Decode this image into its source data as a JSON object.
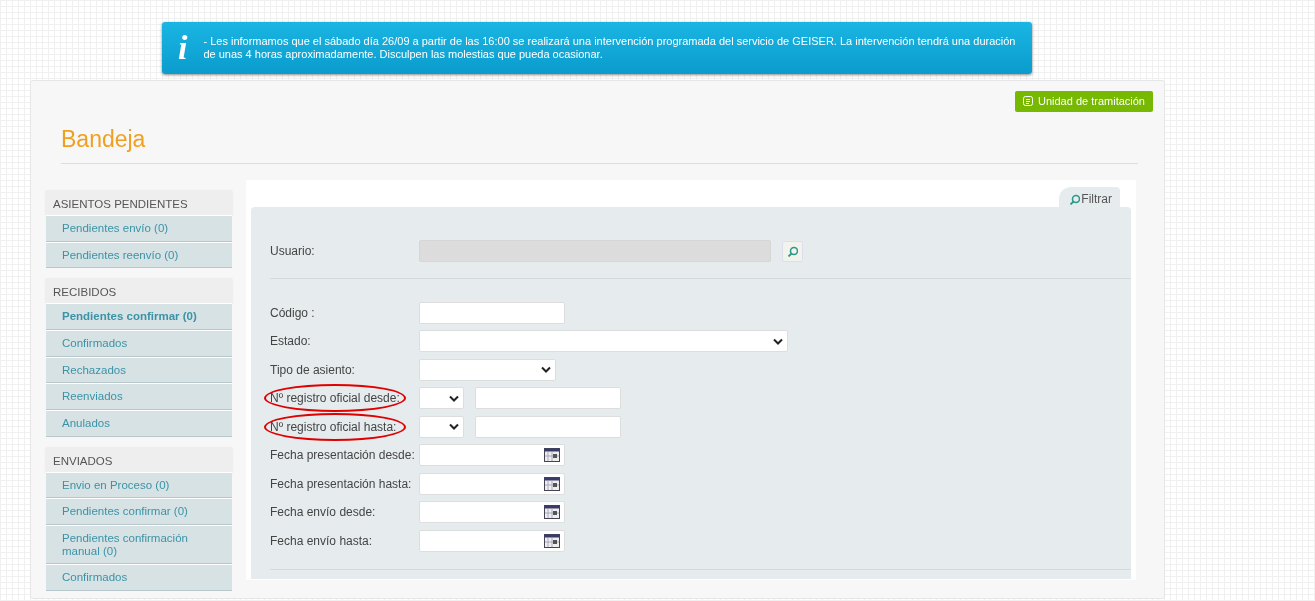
{
  "notice": {
    "icon": "i",
    "text": "- Les informamos que el sábado día 26/09 a partir de las 16:00 se realizará una intervención programada del servicio de GEISER. La intervención tendrá una duración de unas 4 horas aproximadamente. Disculpen las molestias que pueda ocasionar."
  },
  "unit_button": "Unidad de tramitación",
  "title": "Bandeja",
  "sidebar": [
    {
      "header": "ASIENTOS PENDIENTES",
      "items": [
        {
          "label": "Pendientes envío (0)",
          "selected": false
        },
        {
          "label": "Pendientes reenvío (0)",
          "selected": false
        }
      ]
    },
    {
      "header": "RECIBIDOS",
      "items": [
        {
          "label": "Pendientes confirmar (0)",
          "selected": true
        },
        {
          "label": "Confirmados",
          "selected": false
        },
        {
          "label": "Rechazados",
          "selected": false
        },
        {
          "label": "Reenviados",
          "selected": false
        },
        {
          "label": "Anulados",
          "selected": false
        }
      ]
    },
    {
      "header": "ENVIADOS",
      "items": [
        {
          "label": "Envio en Proceso (0)",
          "selected": false
        },
        {
          "label": "Pendientes confirmar (0)",
          "selected": false
        },
        {
          "label": "Pendientes confirmación manual (0)",
          "selected": false
        },
        {
          "label": "Confirmados",
          "selected": false
        }
      ]
    }
  ],
  "filter_tab": "Filtrar",
  "user_field": {
    "label": "Usuario:",
    "disabled": true
  },
  "fields": [
    {
      "kind": "text",
      "label": "Código :",
      "highlighted": false
    },
    {
      "kind": "longselect",
      "label": "Estado:",
      "highlighted": false
    },
    {
      "kind": "select",
      "label": "Tipo de asiento:",
      "highlighted": false
    },
    {
      "kind": "range",
      "label": "Nº registro oficial desde:",
      "highlighted": true
    },
    {
      "kind": "range",
      "label": "Nº registro oficial hasta:",
      "highlighted": true
    },
    {
      "kind": "date",
      "label": "Fecha presentación desde:",
      "highlighted": false
    },
    {
      "kind": "date",
      "label": "Fecha presentación hasta:",
      "highlighted": false
    },
    {
      "kind": "date",
      "label": "Fecha envío desde:",
      "highlighted": false
    },
    {
      "kind": "date",
      "label": "Fecha envío hasta:",
      "highlighted": false
    }
  ]
}
